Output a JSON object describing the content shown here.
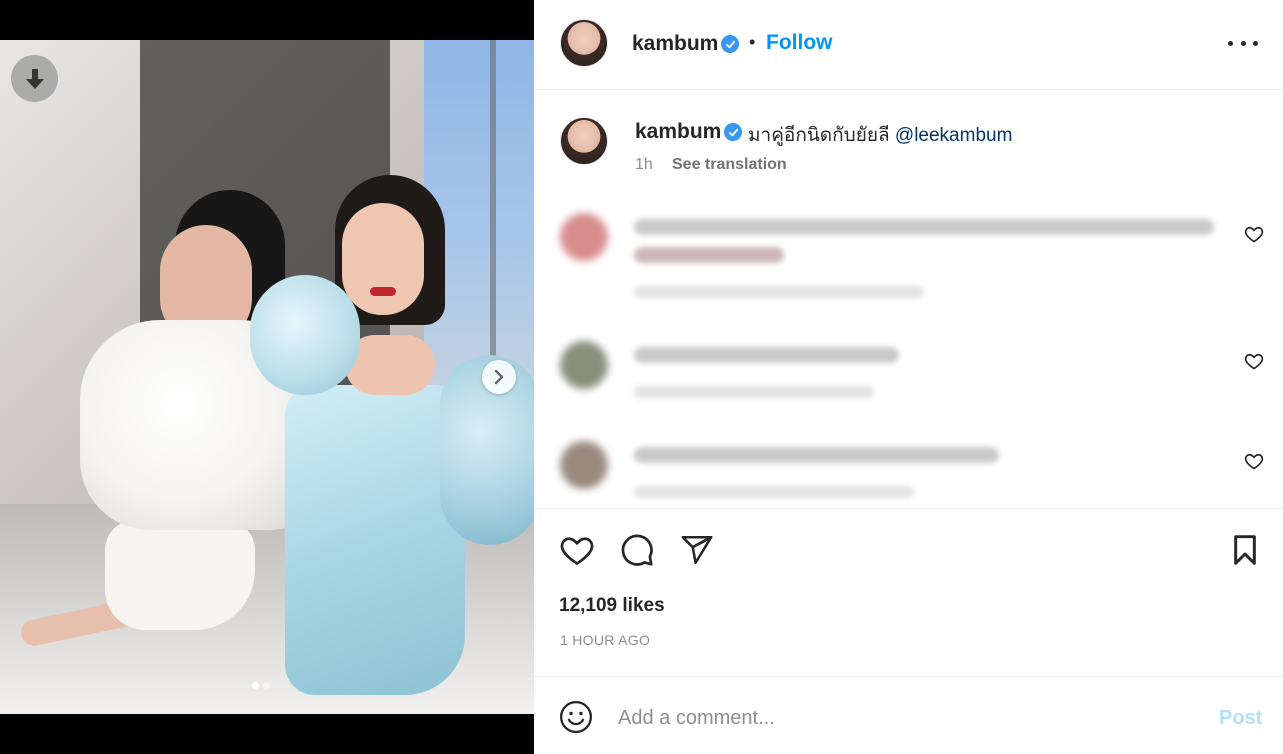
{
  "post": {
    "username": "kambum",
    "follow_label": "Follow",
    "separator": "•",
    "caption_text": "มาคู่อีกนิดกับยัยลี ",
    "caption_mention": "@leekambum",
    "caption_time": "1h",
    "see_translation": "See translation",
    "likes": "12,109 likes",
    "time_ago": "1 HOUR AGO"
  },
  "media": {
    "carousel_count": 2,
    "carousel_active": 1
  },
  "comments": [
    {
      "blurred": true
    },
    {
      "blurred": true
    },
    {
      "blurred": true
    }
  ],
  "comment_box": {
    "placeholder": "Add a comment...",
    "post_label": "Post"
  },
  "colors": {
    "accent": "#0095f6",
    "verified": "#3897f0",
    "post_disabled": "#b2dffc",
    "mention": "#00376b"
  },
  "icons": {
    "download": "download-icon",
    "next": "chevron-right-icon",
    "more": "more-options-icon",
    "like": "heart-icon",
    "comment": "comment-icon",
    "share": "share-icon",
    "save": "bookmark-icon",
    "emoji": "emoji-icon",
    "verified": "verified-badge-icon"
  }
}
